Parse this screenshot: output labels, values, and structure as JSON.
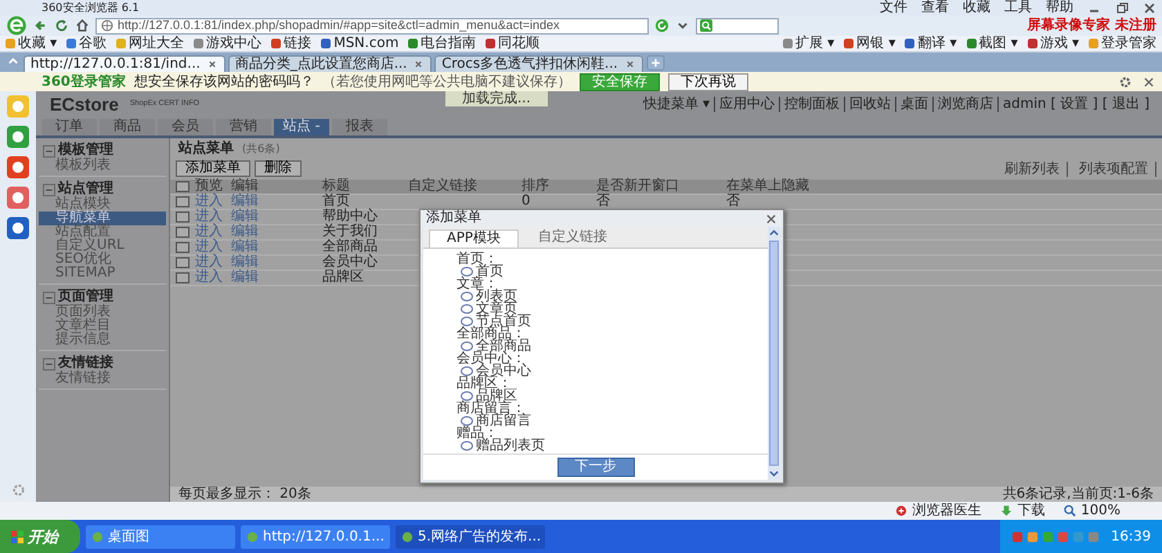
{
  "browser": {
    "title": "360安全浏览器 6.1",
    "menu": [
      "文件",
      "查看",
      "收藏",
      "工具",
      "帮助"
    ],
    "url": "http://127.0.0.1:81/index.php/shopadmin/#app=site&ctl=admin_menu&act=index",
    "banner": "屏幕录像专家 未注册"
  },
  "favorites": [
    "收藏 ▾",
    "谷歌",
    "网址大全",
    "游戏中心",
    "链接",
    "MSN.com",
    "电台指南",
    "同花顺"
  ],
  "favorites_right": [
    "扩展 ▾",
    "网银 ▾",
    "翻译 ▾",
    "截图 ▾",
    "游戏 ▾",
    "登录管家"
  ],
  "browser_tabs": [
    {
      "title": "http://127.0.0.1:81/ind...",
      "selected": true
    },
    {
      "title": "商品分类_点此设置您商店...",
      "selected": false
    },
    {
      "title": "Crocs多色透气拌扣休闲鞋...",
      "selected": false
    }
  ],
  "password_bar": {
    "brand": "360登录管家",
    "question": "想安全保存该网站的密码吗？",
    "hint": "（若您使用网吧等公共电脑不建议保存）",
    "save": "安全保存",
    "later": "下次再说"
  },
  "app": {
    "logo": "ECstore",
    "tagline": "ShopEx CERT INFO",
    "toast": "加载完成...",
    "quick_links": [
      "快捷菜单 ▾",
      "应用中心",
      "控制面板",
      "回收站",
      "桌面",
      "浏览商店",
      "admin [ 设置 ] [ 退出 ]"
    ],
    "nav_tabs": [
      {
        "label": "订单",
        "selected": false
      },
      {
        "label": "商品",
        "selected": false
      },
      {
        "label": "会员",
        "selected": false
      },
      {
        "label": "营销",
        "selected": false
      },
      {
        "label": "站点 -",
        "selected": true
      },
      {
        "label": "报表",
        "selected": false
      }
    ]
  },
  "sidebar": [
    {
      "title": "模板管理",
      "expanded": true,
      "items": [
        {
          "label": "模板列表",
          "selected": false
        }
      ]
    },
    {
      "title": "站点管理",
      "expanded": true,
      "items": [
        {
          "label": "站点模块",
          "selected": false
        },
        {
          "label": "导航菜单",
          "selected": true
        },
        {
          "label": "站点配置",
          "selected": false
        },
        {
          "label": "自定义URL",
          "selected": false
        },
        {
          "label": "SEO优化",
          "selected": false
        },
        {
          "label": "SITEMAP",
          "selected": false
        }
      ]
    },
    {
      "title": "页面管理",
      "expanded": true,
      "items": [
        {
          "label": "页面列表",
          "selected": false
        },
        {
          "label": "文章栏目",
          "selected": false
        },
        {
          "label": "提示信息",
          "selected": false
        }
      ]
    },
    {
      "title": "友情链接",
      "expanded": true,
      "items": [
        {
          "label": "友情链接",
          "selected": false
        }
      ]
    }
  ],
  "main": {
    "title": "站点菜单",
    "count": "(共6条)",
    "buttons": [
      "添加菜单",
      "删除"
    ],
    "tools": [
      "刷新列表",
      "列表项配置"
    ],
    "all_checked": false,
    "columns": [
      "预览",
      "编辑",
      "标题",
      "自定义链接",
      "排序",
      "是否新开窗口",
      "在菜单上隐藏"
    ],
    "rows": [
      {
        "checked": false,
        "preview": "进入",
        "edit": "编辑",
        "title": "首页",
        "sort": "0",
        "new_window": "否",
        "hidden": "否"
      },
      {
        "checked": false,
        "preview": "进入",
        "edit": "编辑",
        "title": "帮助中心"
      },
      {
        "checked": false,
        "preview": "进入",
        "edit": "编辑",
        "title": "关于我们"
      },
      {
        "checked": false,
        "preview": "进入",
        "edit": "编辑",
        "title": "全部商品"
      },
      {
        "checked": false,
        "preview": "进入",
        "edit": "编辑",
        "title": "会员中心"
      },
      {
        "checked": false,
        "preview": "进入",
        "edit": "编辑",
        "title": "品牌区"
      }
    ],
    "page_size": "每页最多显示： 20条",
    "summary": "共6条记录,当前页:1-6条"
  },
  "dialog": {
    "title": "添加菜单",
    "tabs": [
      {
        "label": "APP模块",
        "selected": true
      },
      {
        "label": "自定义链接",
        "selected": false
      }
    ],
    "groups": [
      {
        "label": "首页：",
        "options": [
          {
            "label": "首页",
            "selected": false
          }
        ]
      },
      {
        "label": "文章：",
        "options": [
          {
            "label": "列表页",
            "selected": false
          },
          {
            "label": "文章页",
            "selected": false
          },
          {
            "label": "节点首页",
            "selected": false
          }
        ]
      },
      {
        "label": "全部商品：",
        "options": [
          {
            "label": "全部商品",
            "selected": false
          }
        ]
      },
      {
        "label": "会员中心：",
        "options": [
          {
            "label": "会员中心",
            "selected": false
          }
        ]
      },
      {
        "label": "品牌区：",
        "options": [
          {
            "label": "品牌区",
            "selected": false
          }
        ]
      },
      {
        "label": "商店留言：",
        "options": [
          {
            "label": "商店留言",
            "selected": false
          }
        ]
      },
      {
        "label": "赠品：",
        "options": [
          {
            "label": "赠品列表页",
            "selected": false
          }
        ]
      }
    ],
    "next": "下一步"
  },
  "status_bar": [
    "浏览器医生",
    "下载",
    "100%"
  ],
  "taskbar": {
    "start": "开始",
    "tasks": [
      {
        "title": "桌面图",
        "selected": false
      },
      {
        "title": "http://127.0.0.1...",
        "selected": false
      },
      {
        "title": "5.网络广告的发布...",
        "selected": true
      }
    ],
    "clock": "16:39"
  }
}
